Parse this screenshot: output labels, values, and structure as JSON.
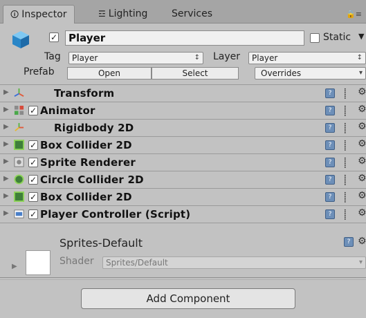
{
  "tabs": [
    {
      "label": "Inspector",
      "icon": "info-icon"
    },
    {
      "label": "Lighting",
      "icon": "lighting-icon"
    },
    {
      "label": "Services"
    }
  ],
  "gameobject": {
    "active": true,
    "name": "Player",
    "static_label": "Static",
    "static_checked": false,
    "tag_label": "Tag",
    "tag_value": "Player",
    "layer_label": "Layer",
    "layer_value": "Player",
    "prefab_label": "Prefab",
    "open_label": "Open",
    "select_label": "Select",
    "overrides_label": "Overrides"
  },
  "components": [
    {
      "name": "Transform",
      "icon": "transform-icon",
      "has_checkbox": false
    },
    {
      "name": "Animator",
      "icon": "animator-icon",
      "has_checkbox": true,
      "checked": true
    },
    {
      "name": "Rigidbody 2D",
      "icon": "rigidbody-icon",
      "has_checkbox": false
    },
    {
      "name": "Box Collider 2D",
      "icon": "box-collider-icon",
      "has_checkbox": true,
      "checked": true
    },
    {
      "name": "Sprite Renderer",
      "icon": "sprite-renderer-icon",
      "has_checkbox": true,
      "checked": true
    },
    {
      "name": "Circle Collider 2D",
      "icon": "circle-collider-icon",
      "has_checkbox": true,
      "checked": true
    },
    {
      "name": "Box Collider 2D",
      "icon": "box-collider-icon",
      "has_checkbox": true,
      "checked": true
    },
    {
      "name": "Player Controller (Script)",
      "icon": "script-icon",
      "has_checkbox": true,
      "checked": true
    }
  ],
  "material": {
    "name": "Sprites-Default",
    "shader_label": "Shader",
    "shader_value": "Sprites/Default"
  },
  "add_component_label": "Add Component"
}
